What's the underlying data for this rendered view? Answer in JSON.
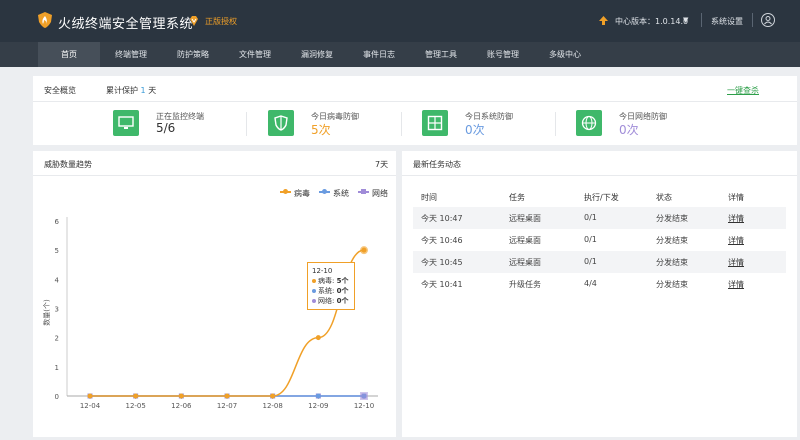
{
  "header": {
    "app_title": "火绒终端安全管理系统",
    "license_label": "正版授权",
    "version_label": "中心版本：1.0.14.0",
    "settings_label": "系统设置",
    "colors": {
      "header_bg": "#2b3540",
      "nav_bg": "#353e48",
      "accent": "#f0a028"
    }
  },
  "nav": {
    "items": [
      {
        "label": "首页",
        "active": true
      },
      {
        "label": "终端管理"
      },
      {
        "label": "防护策略"
      },
      {
        "label": "文件管理"
      },
      {
        "label": "漏洞修复"
      },
      {
        "label": "事件日志"
      },
      {
        "label": "管理工具"
      },
      {
        "label": "账号管理"
      },
      {
        "label": "多级中心"
      }
    ]
  },
  "overview": {
    "title": "安全概览",
    "accumulated_label": "累计保护",
    "accumulated_days": "1",
    "accumulated_unit": "天",
    "link": "一键查杀",
    "stats": [
      {
        "label": "正在监控终端",
        "value": "5/6",
        "icon": "monitor-icon",
        "value_color": "#333333"
      },
      {
        "label": "今日病毒防御",
        "value": "5次",
        "icon": "shield-icon",
        "value_color": "#f0a028"
      },
      {
        "label": "今日系统防御",
        "value": "0次",
        "icon": "windows-icon",
        "value_color": "#6a9be0"
      },
      {
        "label": "今日网络防御",
        "value": "0次",
        "icon": "globe-icon",
        "value_color": "#a08cd8"
      }
    ]
  },
  "threat_panel": {
    "title": "威胁数量趋势",
    "range": "7天",
    "tooltip": {
      "date": "12-10",
      "rows": [
        {
          "name": "病毒",
          "value": "5个",
          "color": "#f0a028"
        },
        {
          "name": "系统",
          "value": "0个",
          "color": "#6a9be0"
        },
        {
          "name": "网络",
          "value": "0个",
          "color": "#a08cd8"
        }
      ]
    }
  },
  "chart_data": {
    "type": "line",
    "ylabel": "数量(个)",
    "x": [
      "12-04",
      "12-05",
      "12-06",
      "12-07",
      "12-08",
      "12-09",
      "12-10"
    ],
    "ylim": [
      0,
      6
    ],
    "yticks": [
      0,
      1,
      2,
      3,
      4,
      5,
      6
    ],
    "legend_position": "top-right",
    "grid": false,
    "series": [
      {
        "name": "病毒",
        "values": [
          0,
          0,
          0,
          0,
          0,
          2,
          5
        ],
        "color": "#f0a028"
      },
      {
        "name": "系统",
        "values": [
          0,
          0,
          0,
          0,
          0,
          0,
          0
        ],
        "color": "#6a9be0"
      },
      {
        "name": "网络",
        "values": [
          0,
          0,
          0,
          0,
          0,
          0,
          0
        ],
        "color": "#a08cd8"
      }
    ]
  },
  "tasks_panel": {
    "title": "最新任务动态",
    "columns": [
      "时间",
      "任务",
      "执行/下发",
      "状态",
      "详情"
    ],
    "rows": [
      {
        "time": "今天 10:47",
        "task": "远程桌面",
        "exec": "0/1",
        "status": "分发结束",
        "detail": "详情"
      },
      {
        "time": "今天 10:46",
        "task": "远程桌面",
        "exec": "0/1",
        "status": "分发结束",
        "detail": "详情"
      },
      {
        "time": "今天 10:45",
        "task": "远程桌面",
        "exec": "0/1",
        "status": "分发结束",
        "detail": "详情"
      },
      {
        "time": "今天 10:41",
        "task": "升级任务",
        "exec": "4/4",
        "status": "分发结束",
        "detail": "详情"
      }
    ]
  }
}
